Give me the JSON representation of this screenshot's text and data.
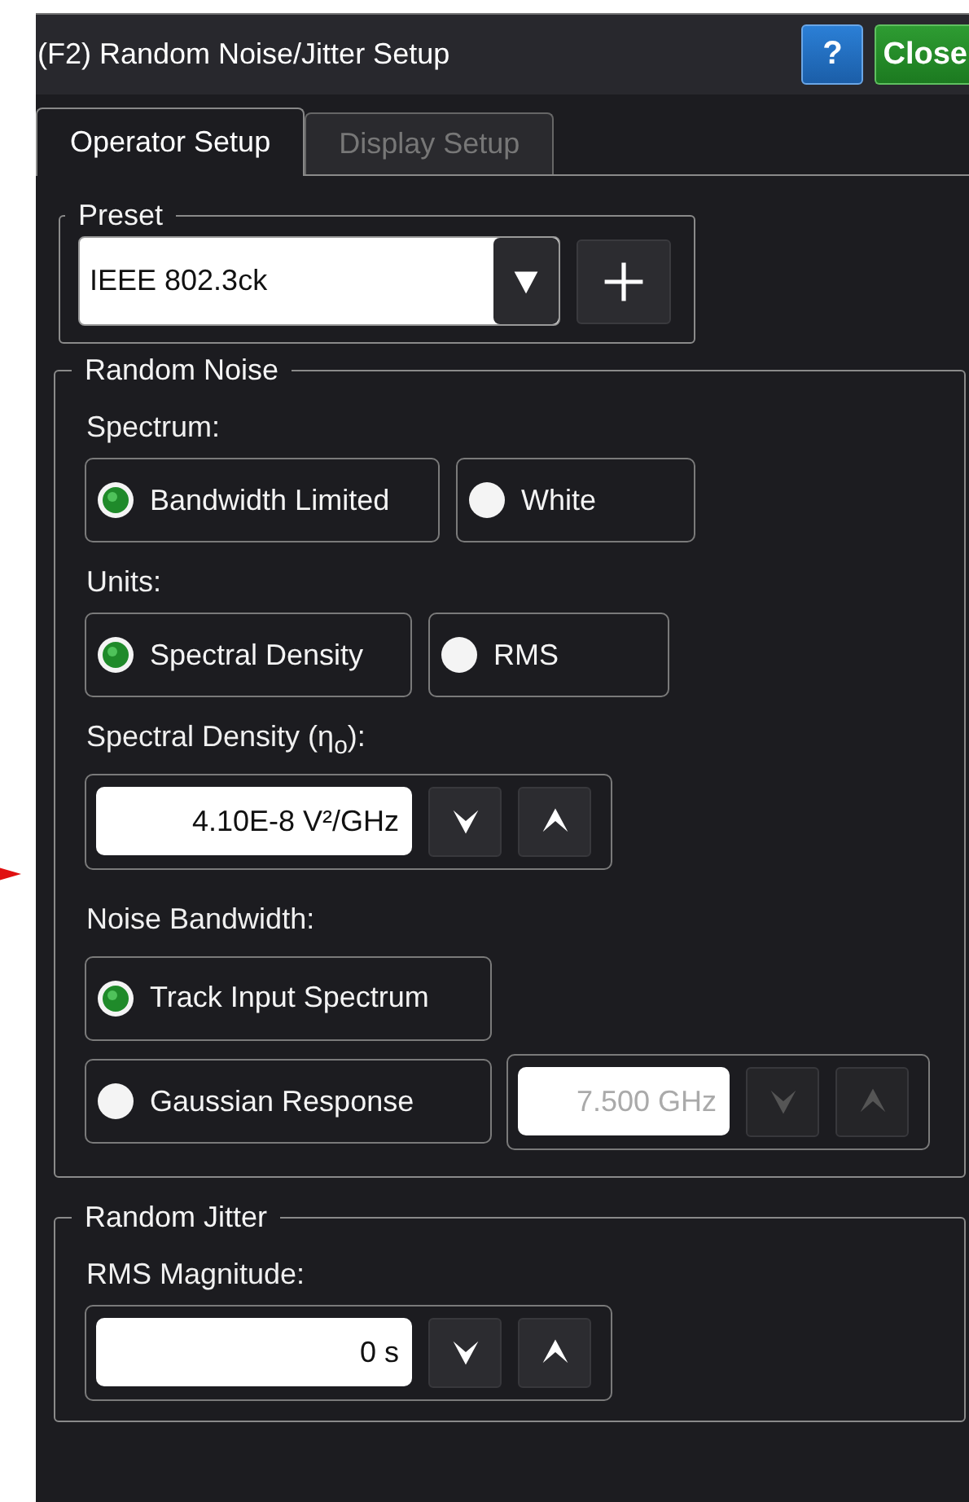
{
  "window": {
    "title": "(F2) Random Noise/Jitter Setup",
    "help_button": "?",
    "close_button": "Close"
  },
  "tabs": [
    {
      "label": "Operator Setup",
      "selected": true
    },
    {
      "label": "Display Setup",
      "selected": false
    }
  ],
  "preset": {
    "title": "Preset",
    "value": "IEEE 802.3ck"
  },
  "random_noise": {
    "title": "Random Noise",
    "spectrum": {
      "label": "Spectrum:",
      "options": [
        {
          "label": "Bandwidth Limited",
          "selected": true
        },
        {
          "label": "White",
          "selected": false
        }
      ]
    },
    "units": {
      "label": "Units:",
      "options": [
        {
          "label": "Spectral Density",
          "selected": true
        },
        {
          "label": "RMS",
          "selected": false
        }
      ]
    },
    "spectral_density": {
      "label": "Spectral Density (η$_{o}$):",
      "value": "4.10E-8 V²/GHz"
    },
    "noise_bandwidth": {
      "label": "Noise Bandwidth:",
      "options": [
        {
          "label": "Track Input Spectrum",
          "selected": true
        },
        {
          "label": "Gaussian Response",
          "selected": false,
          "field": {
            "value": "7.500 GHz",
            "disabled": true
          }
        }
      ]
    }
  },
  "random_jitter": {
    "title": "Random Jitter",
    "rms_magnitude": {
      "label": "RMS Magnitude:",
      "value": "0 s"
    }
  }
}
